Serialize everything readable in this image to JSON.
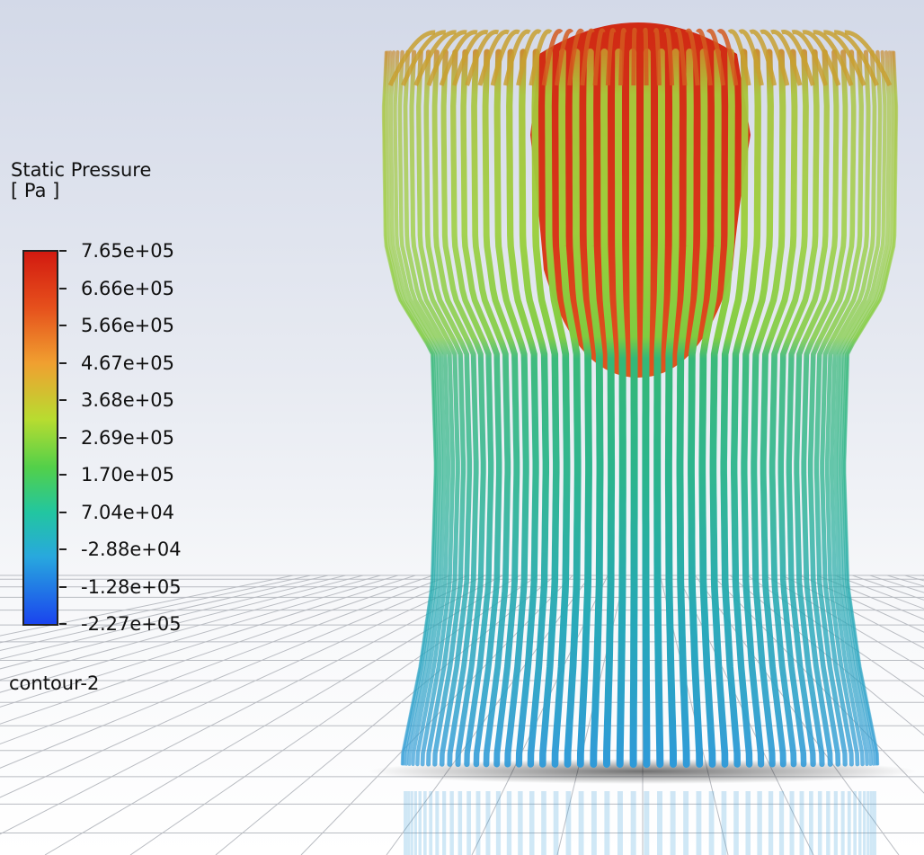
{
  "legend": {
    "title_line1": "Static Pressure",
    "title_line2": "[ Pa ]",
    "ticks": [
      "7.65e+05",
      "6.66e+05",
      "5.66e+05",
      "4.67e+05",
      "3.68e+05",
      "2.69e+05",
      "1.70e+05",
      "7.04e+04",
      "-2.88e+04",
      "-1.28e+05",
      "-2.27e+05"
    ],
    "colors": {
      "max": "#d21a10",
      "mid_high": "#f0a030",
      "mid": "#52d04a",
      "mid_low": "#22c6a0",
      "min": "#1a44ee"
    }
  },
  "contour_name": "contour-2"
}
